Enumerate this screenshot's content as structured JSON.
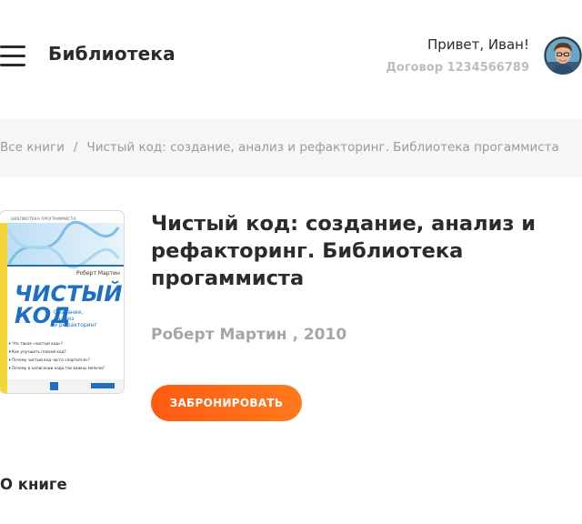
{
  "header": {
    "app_title": "Библиотека",
    "greeting": "Привет, Иван!",
    "contract": "Договор 1234566789"
  },
  "breadcrumb": {
    "root": "Все книги",
    "separator": "/",
    "current": "Чистый код: создание, анализ и рефакторинг. Библиотека прогаммиста"
  },
  "book": {
    "title": "Чистый код: создание, анализ и рефакторинг. Библиотека прогаммиста",
    "author_year": "Роберт Мартин , 2010",
    "cover": {
      "series": "БИБЛИОТЕКА ПРОГРАММИСТА",
      "author": "Роберт Мартин",
      "title_line1": "ЧИСТЫЙ",
      "title_line2": "КОД",
      "subtitle_line1": "Создание,",
      "subtitle_line2": "анализ",
      "subtitle_line3": "и рефакторинг",
      "bullets": [
        "Что такое «чистый код»?",
        "Как улучшить плохой код?",
        "Почему чистый код часто «портится»?",
        "Почему в написании кода так важны мелочи?"
      ]
    },
    "reserve_label": "ЗАБРОНИРОВАТЬ"
  },
  "about": {
    "title": "О книге"
  },
  "colors": {
    "accent": "#ff6a18",
    "text": "#2b2b2b",
    "muted": "#a6a6a6",
    "band": "#f6f6f6",
    "cover_blue": "#1e6fc4"
  }
}
